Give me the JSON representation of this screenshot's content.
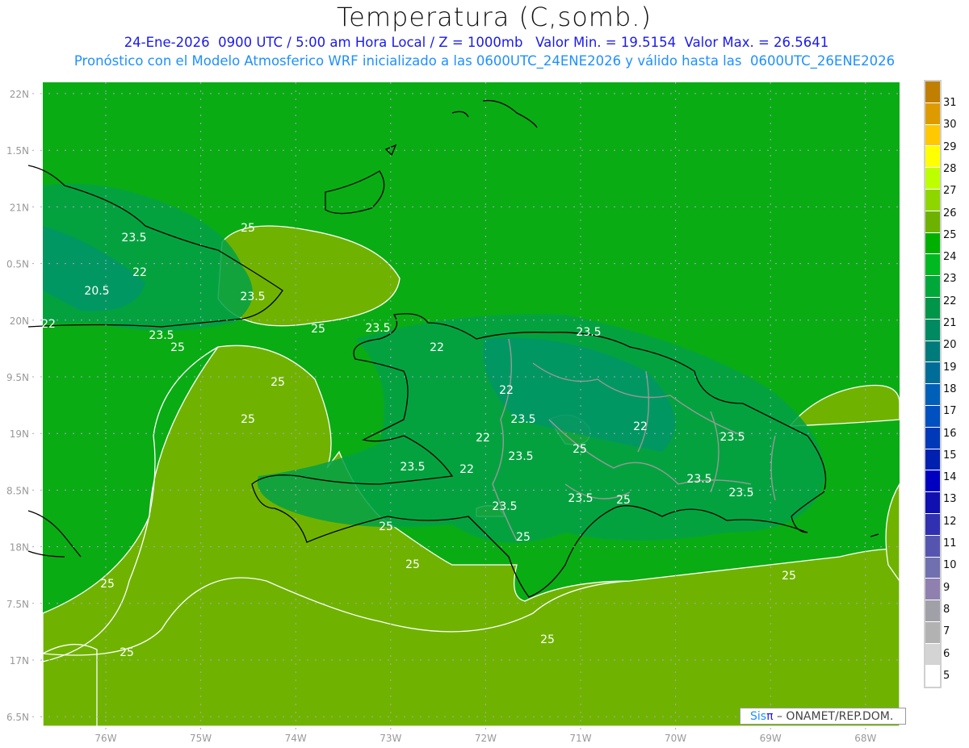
{
  "header": {
    "title": "Temperatura (C,somb.)",
    "line1": "24-Ene-2026  0900 UTC / 5:00 am Hora Local / Z = 1000mb   Valor Min. = 19.5154  Valor Max. = 26.5641",
    "line2": "Pronóstico con el Modelo Atmosferico WRF inicializado a las 0600UTC_24ENE2026 y válido hasta las  0600UTC_26ENE2026"
  },
  "axes": {
    "lat_labels": [
      "22N",
      "1.5N",
      "21N",
      "0.5N",
      "20N",
      "9.5N",
      "19N",
      "8.5N",
      "18N",
      "7.5N",
      "17N",
      "6.5N"
    ],
    "lon_labels": [
      "76W",
      "75W",
      "74W",
      "73W",
      "72W",
      "71W",
      "70W",
      "69W",
      "68W"
    ]
  },
  "colorbar": {
    "labels": [
      "31",
      "30",
      "29",
      "28",
      "27",
      "26",
      "25",
      "24",
      "23",
      "22",
      "21",
      "20",
      "19",
      "18",
      "17",
      "16",
      "15",
      "14",
      "13",
      "12",
      "11",
      "10",
      "9",
      "8",
      "7",
      "6",
      "5"
    ],
    "colors": [
      "#c07f00",
      "#de9b00",
      "#ffc800",
      "#ffff00",
      "#beff00",
      "#8fd600",
      "#6eb200",
      "#00b000",
      "#00b820",
      "#00a83a",
      "#009548",
      "#008a62",
      "#007b7b",
      "#006d98",
      "#0060b8",
      "#0050c0",
      "#0038b8",
      "#0020b0",
      "#0000c0",
      "#1010b0",
      "#3030b0",
      "#5555b0",
      "#7070b0",
      "#9080b0",
      "#a0a0a8",
      "#b2b2b2",
      "#d4d4d4",
      "#ffffff"
    ]
  },
  "contour_labels": [
    "25",
    "23.5",
    "22",
    "20.5",
    "23.5",
    "22",
    "23.5",
    "25",
    "25",
    "25",
    "25",
    "23.5",
    "22",
    "23.5",
    "22",
    "22",
    "23.5",
    "25",
    "23.5",
    "23.5",
    "22",
    "23.5",
    "23.5",
    "23.5",
    "25",
    "22",
    "23.5",
    "23.5",
    "25",
    "25",
    "25",
    "25",
    "25",
    "25",
    "25"
  ],
  "credit": {
    "brand_a": "Sis",
    "brand_b": "π",
    "text": "– ONAMET/REP.DOM."
  }
}
